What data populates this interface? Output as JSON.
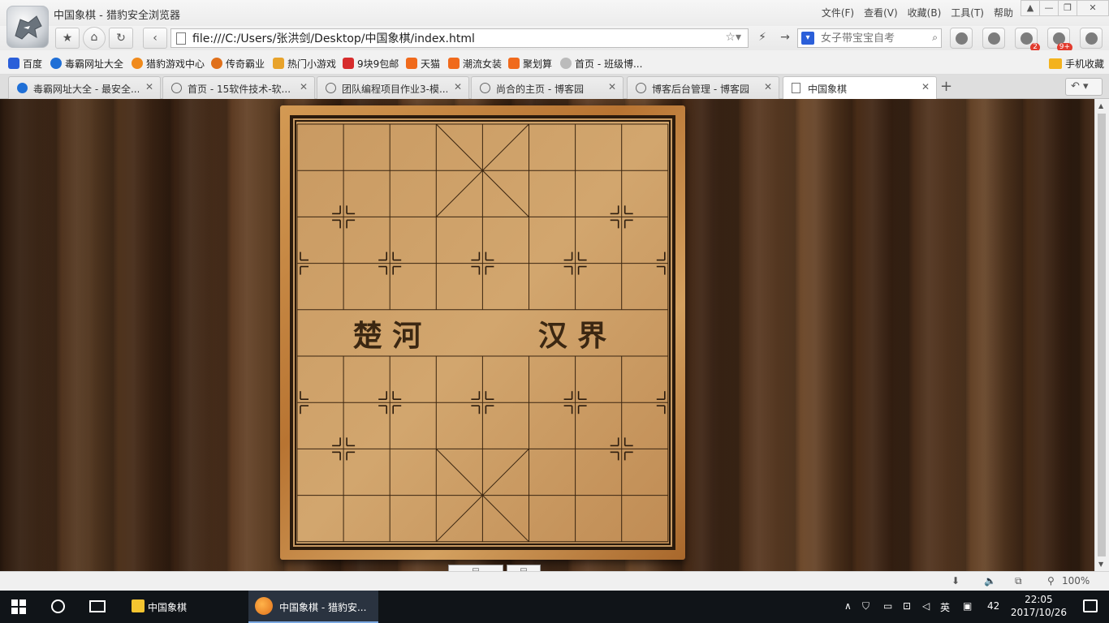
{
  "window": {
    "title": "中国象棋 - 猎豹安全浏览器"
  },
  "menu": {
    "items": [
      "文件(F)",
      "查看(V)",
      "收藏(B)",
      "工具(T)",
      "帮助"
    ]
  },
  "nav": {
    "url": "file:///C:/Users/张洪剑/Desktop/中国象棋/index.html",
    "search_placeholder": "女子带宝宝自考",
    "download_badge": "2",
    "game_badge": "9+"
  },
  "bookmarks": {
    "items": [
      "百度",
      "毒霸网址大全",
      "猎豹游戏中心",
      "传奇霸业",
      "热门小游戏",
      "9块9包邮",
      "天猫",
      "潮流女装",
      "聚划算",
      "首页 - 班级博..."
    ],
    "mobile": "手机收藏"
  },
  "tabs": [
    {
      "label": "毒霸网址大全 - 最安全...",
      "active": false
    },
    {
      "label": "首页 - 15软件技术-软...",
      "active": false
    },
    {
      "label": "团队编程项目作业3-模...",
      "active": false
    },
    {
      "label": "尚合的主页 - 博客园",
      "active": false
    },
    {
      "label": "博客后台管理 - 博客园",
      "active": false
    },
    {
      "label": "中国象棋",
      "active": true
    }
  ],
  "board": {
    "river_left": "楚 河",
    "river_right": "汉 界"
  },
  "status": {
    "zoom": "100%"
  },
  "taskbar": {
    "items": [
      {
        "label": "中国象棋",
        "active": false
      },
      {
        "label": "中国象棋 - 猎豹安...",
        "active": true
      }
    ],
    "ime": "英",
    "tray_count": "42",
    "time": "22:05",
    "date": "2017/10/26"
  },
  "colors": {
    "board_line": "#2a1a0c",
    "board_wood": "#c9985c",
    "frame": "#b87432",
    "taskbar": "#101418"
  }
}
